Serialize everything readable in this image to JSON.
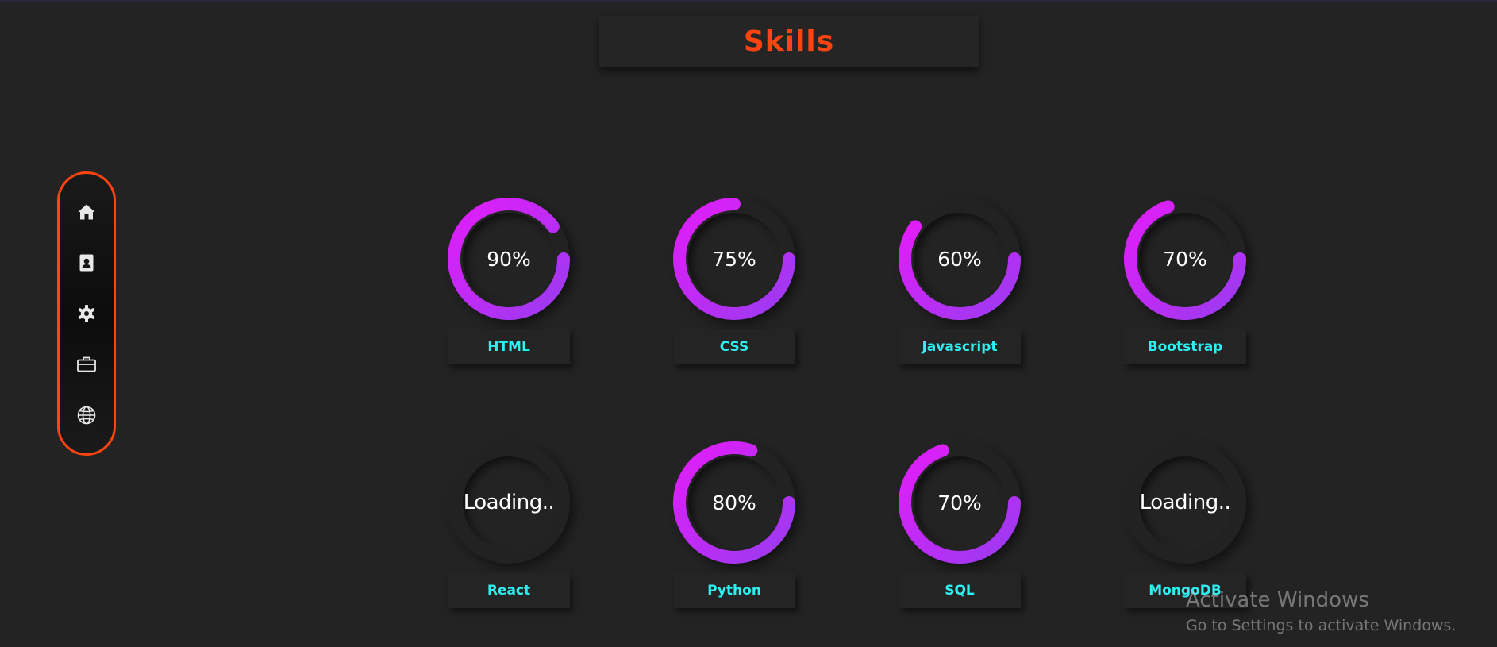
{
  "title": "Skills",
  "colors": {
    "background": "#232323",
    "title": "#ff4411",
    "sidebar_border": "#ff4411",
    "label": "#2ef0f0",
    "ring_start": "#e21dfa",
    "ring_end": "#9a3bf0"
  },
  "sidebar": {
    "items": [
      {
        "icon": "home-icon"
      },
      {
        "icon": "contact-card-icon"
      },
      {
        "icon": "gear-icon"
      },
      {
        "icon": "briefcase-icon"
      },
      {
        "icon": "globe-icon"
      }
    ]
  },
  "skills": [
    {
      "name": "HTML",
      "display": "90%",
      "value": 90
    },
    {
      "name": "CSS",
      "display": "75%",
      "value": 75
    },
    {
      "name": "Javascript",
      "display": "60%",
      "value": 60
    },
    {
      "name": "Bootstrap",
      "display": "70%",
      "value": 70
    },
    {
      "name": "React",
      "display": "Loading..",
      "value": 0
    },
    {
      "name": "Python",
      "display": "80%",
      "value": 80
    },
    {
      "name": "SQL",
      "display": "70%",
      "value": 70
    },
    {
      "name": "MongoDB",
      "display": "Loading..",
      "value": 0
    }
  ],
  "watermark": {
    "title": "Activate Windows",
    "subtitle": "Go to Settings to activate Windows."
  }
}
